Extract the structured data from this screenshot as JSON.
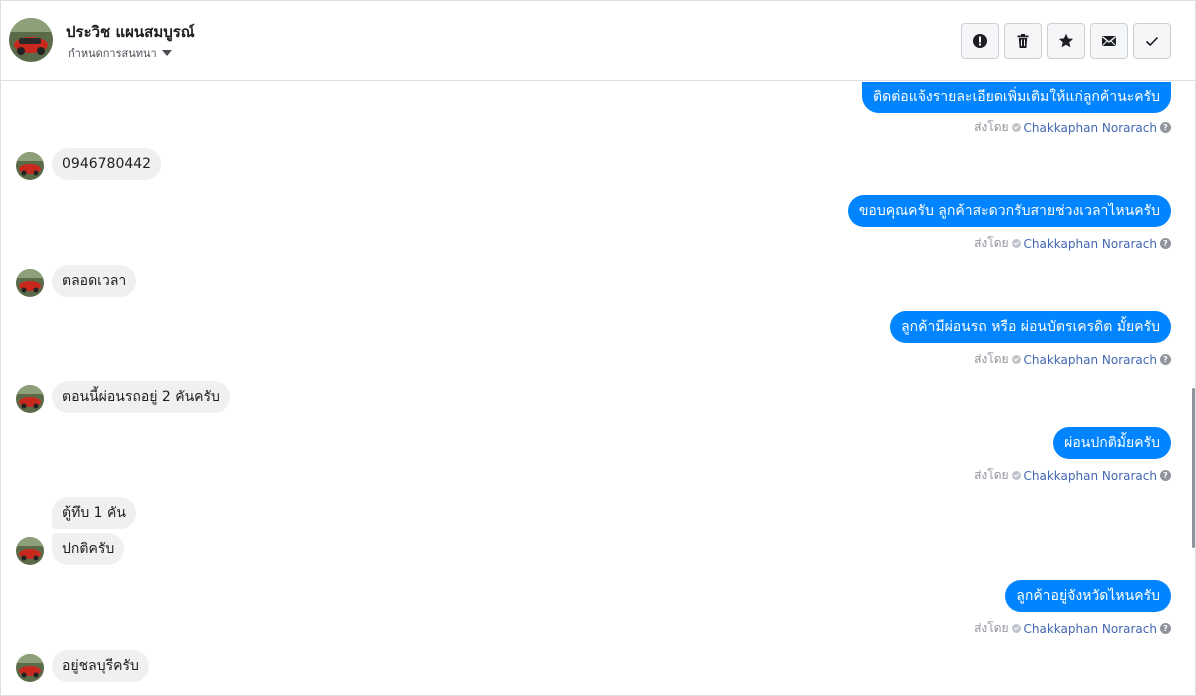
{
  "header": {
    "contact_name": "ประวิช แผนสมบูรณ์",
    "status_label": "กำหนดการสนทนา",
    "actions": [
      {
        "name": "mark-spam-button",
        "icon": "alert-circle-icon"
      },
      {
        "name": "delete-button",
        "icon": "trash-icon"
      },
      {
        "name": "star-button",
        "icon": "star-icon"
      },
      {
        "name": "mark-unread-button",
        "icon": "envelope-icon"
      },
      {
        "name": "mark-done-button",
        "icon": "checkmark-icon"
      }
    ]
  },
  "sent_by": {
    "label": "ส่งโดย",
    "agent": "Chakkaphan Norarach"
  },
  "messages": {
    "out_0": "ติดต่อแจ้งรายละเอียดเพิ่มเติมให้แก่ลูกค้านะครับ",
    "in_1": "0946780442",
    "out_2": "ขอบคุณครับ ลูกค้าสะดวกรับสายช่วงเวลาไหนครับ",
    "in_3": "ตลอดเวลา",
    "out_4": "ลูกค้ามีผ่อนรถ หรือ ผ่อนบัตรเครดิต มั้ยครับ",
    "in_5": "ตอนนี้ผ่อนรถอยู่ 2 คันครับ",
    "out_6": "ผ่อนปกติมั้ยครับ",
    "in_7a": "ตู้ทึบ 1 คัน",
    "in_7b": "ปกติครับ",
    "out_8": "ลูกค้าอยู่จังหวัดไหนครับ",
    "in_9": "อยู่ชลบุรีครับ"
  },
  "colors": {
    "outgoing_bubble": "#0084ff",
    "incoming_bubble": "#f1f0f0",
    "agent_link": "#4267b2"
  }
}
